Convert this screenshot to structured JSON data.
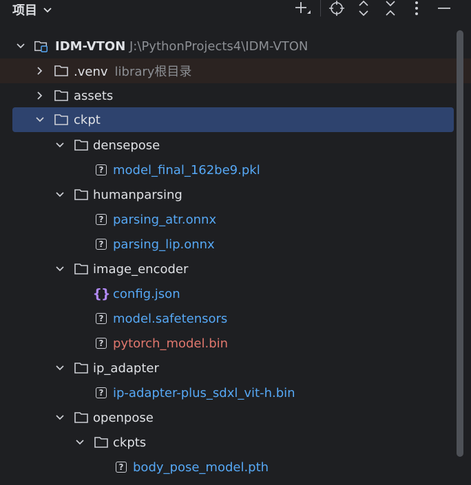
{
  "header": {
    "title": "项目",
    "tools": [
      "add-icon",
      "locate-icon",
      "expand-all-icon",
      "collapse-all-icon",
      "more-icon",
      "minimize-icon"
    ]
  },
  "tree": {
    "root": {
      "name": "IDM-VTON",
      "path": "J:\\PythonProjects4\\IDM-VTON"
    },
    "venv": {
      "name": ".venv",
      "hint": "library根目录"
    },
    "assets": "assets",
    "ckpt": "ckpt",
    "densepose": "densepose",
    "model_final": "model_final_162be9.pkl",
    "humanparsing": "humanparsing",
    "parsing_atr": "parsing_atr.onnx",
    "parsing_lip": "parsing_lip.onnx",
    "image_encoder": "image_encoder",
    "config_json": "config.json",
    "model_safetensors": "model.safetensors",
    "pytorch_model_bin": "pytorch_model.bin",
    "ip_adapter": "ip_adapter",
    "ip_adapter_bin": "ip-adapter-plus_sdxl_vit-h.bin",
    "openpose": "openpose",
    "ckpts": "ckpts",
    "body_pose_model": "body_pose_model.pth"
  },
  "colors": {
    "background": "#1e1f22",
    "selection": "#2e436e",
    "excluded_row": "#2b2321",
    "file_blue": "#56a8f5",
    "file_red": "#e0776d",
    "json_purple": "#b189f5",
    "hint_gray": "#8c8f94"
  }
}
